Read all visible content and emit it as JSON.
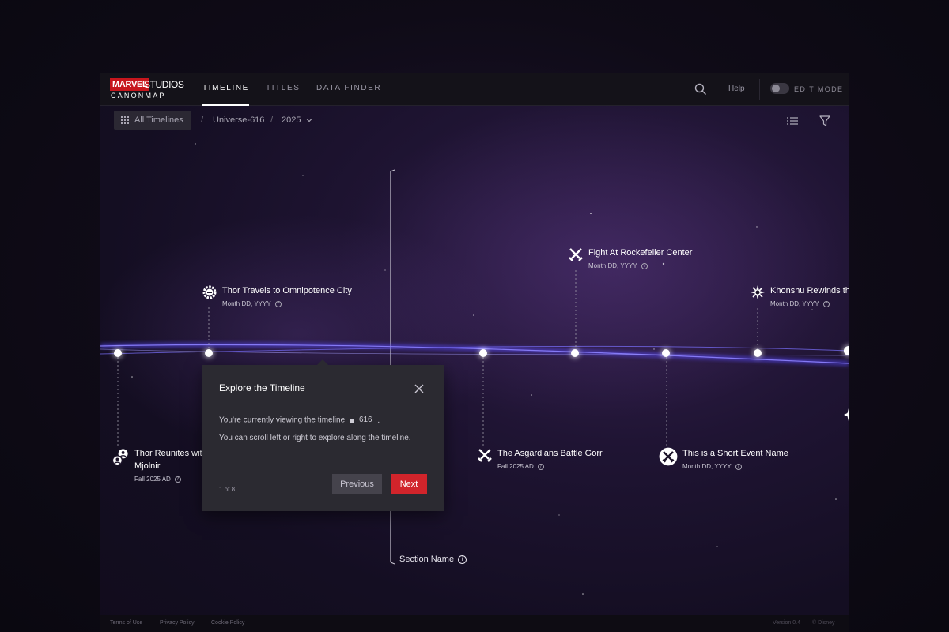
{
  "logo": {
    "marvel": "MARVEL",
    "studios": "STUDIOS",
    "canonmap": "CANONMAP"
  },
  "nav": {
    "tabs": [
      {
        "label": "TIMELINE",
        "active": true
      },
      {
        "label": "TITLES",
        "active": false
      },
      {
        "label": "DATA FINDER",
        "active": false
      }
    ],
    "help": "Help",
    "edit_mode": "EDIT MODE",
    "edit_mode_on": false
  },
  "breadcrumb": {
    "all_timelines": "All Timelines",
    "items": [
      "Universe-616",
      "2025"
    ],
    "separator": "/",
    "dropdown_icon": "chevron-down-icon"
  },
  "events": [
    {
      "title": "Thor Travels to Omnipotence City",
      "date": "Month DD, YYYY",
      "icon": "gear-helmet-icon"
    },
    {
      "title": "Fight At Rockefeller Center",
      "date": "Month DD, YYYY",
      "icon": "crossed-swords-icon"
    },
    {
      "title": "Khonshu Rewinds the",
      "date": "Month DD, YYYY",
      "icon": "starburst-icon"
    },
    {
      "title": "Thor Reunites with",
      "title2": "Mjolnir",
      "date": "Fall 2025 AD",
      "icon": "people-icon"
    },
    {
      "title": "The Asgardians Battle Gorr",
      "date": "Fall 2025 AD",
      "icon": "crossed-swords-icon"
    },
    {
      "title": "This is a Short Event Name",
      "date": "Month DD, YYYY",
      "icon": "crossed-swords-circle-icon"
    }
  ],
  "section": {
    "label": "Section Name"
  },
  "tooltip": {
    "title": "Explore the Timeline",
    "line1": "You’re currently viewing the timeline",
    "timeline_id": "616",
    "line1_end": ".",
    "line2": "You can scroll left or right to explore along the timeline.",
    "step": "1 of 8",
    "prev": "Previous",
    "next": "Next"
  },
  "footer": {
    "links": [
      "Terms of Use",
      "Privacy Policy",
      "Cookie Policy"
    ],
    "version": "Version 0.4",
    "copyright": "© Disney"
  },
  "colors": {
    "accent": "#d1242b",
    "brand": "#c7161d",
    "timeline": "#6b5cff"
  }
}
